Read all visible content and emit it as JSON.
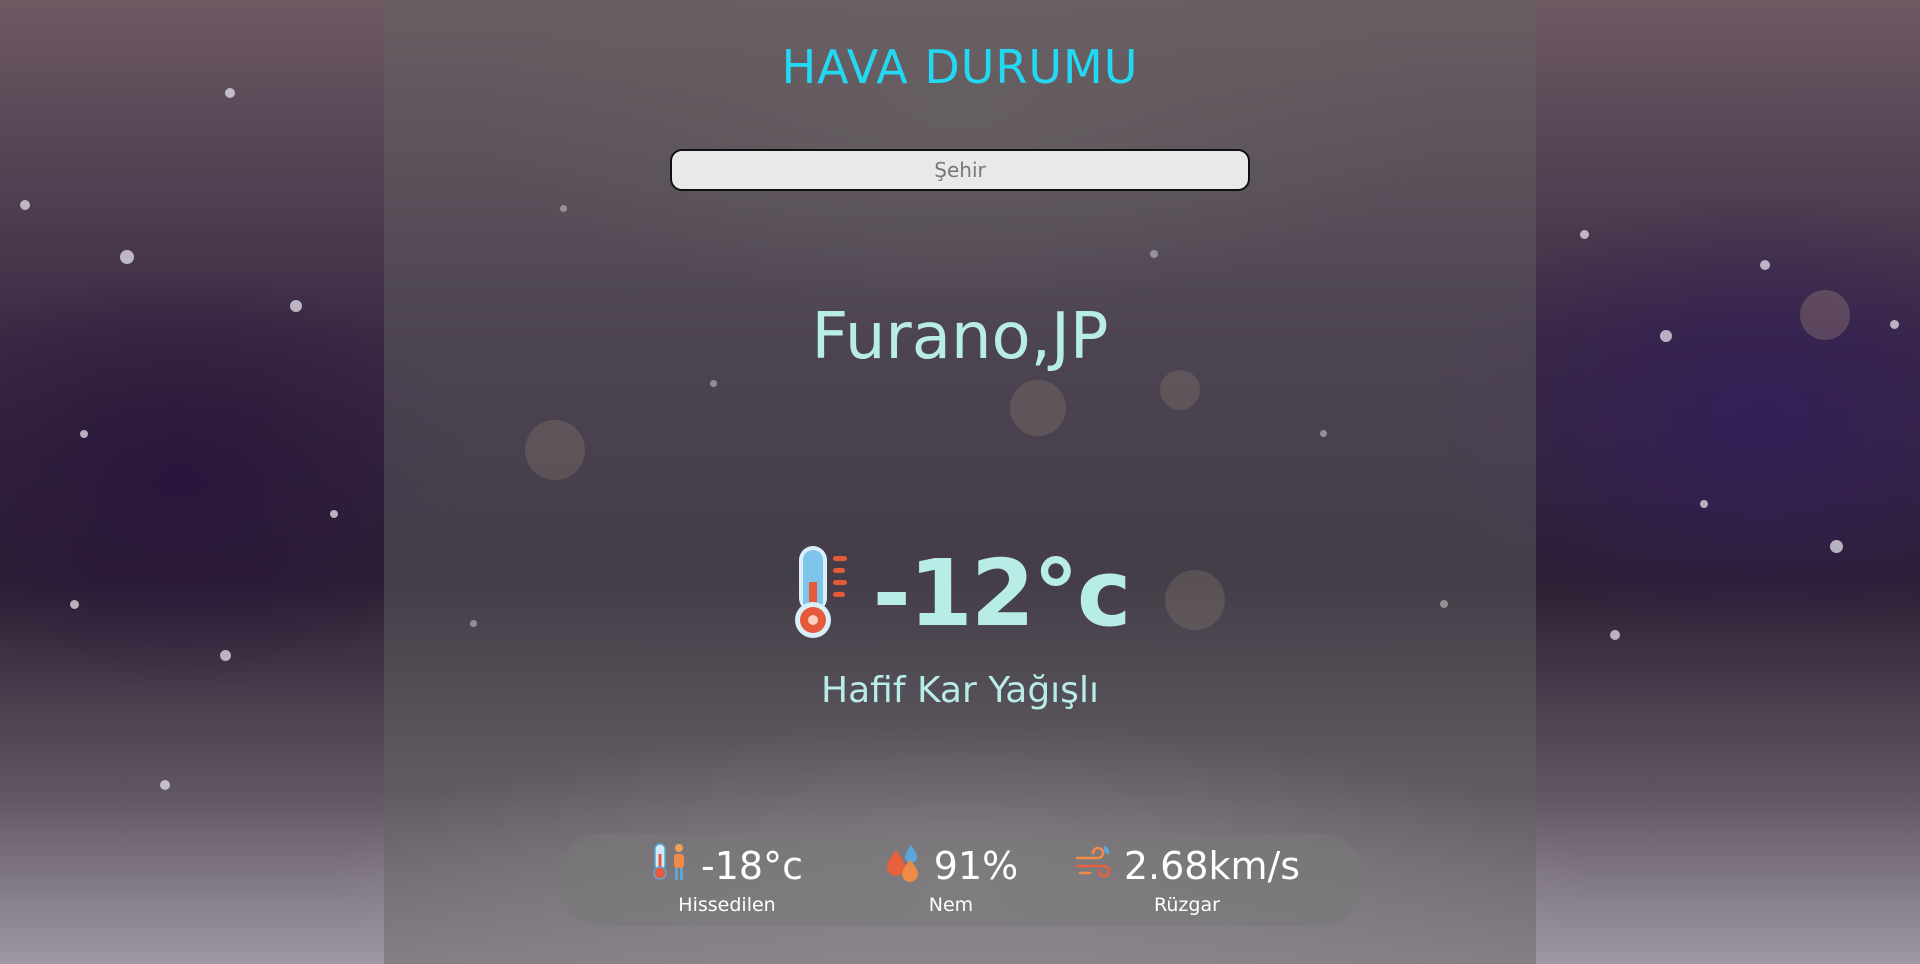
{
  "header": {
    "title": "HAVA DURUMU"
  },
  "search": {
    "placeholder": "Şehir",
    "value": ""
  },
  "weather": {
    "city": "Furano,JP",
    "temperature": "-12°c",
    "description": "Hafif Kar Yağışlı"
  },
  "stats": [
    {
      "value": "-18°c",
      "label": "Hissedilen",
      "icon": "feels-like-thermometer-person-icon"
    },
    {
      "value": "91%",
      "label": "Nem",
      "icon": "humidity-drops-icon"
    },
    {
      "value": "2.68km/s",
      "label": "Rüzgar",
      "icon": "wind-icon"
    }
  ],
  "colors": {
    "title": "#23d8f2",
    "primary_text": "#b8ece6",
    "stat_text": "#ffffff"
  }
}
